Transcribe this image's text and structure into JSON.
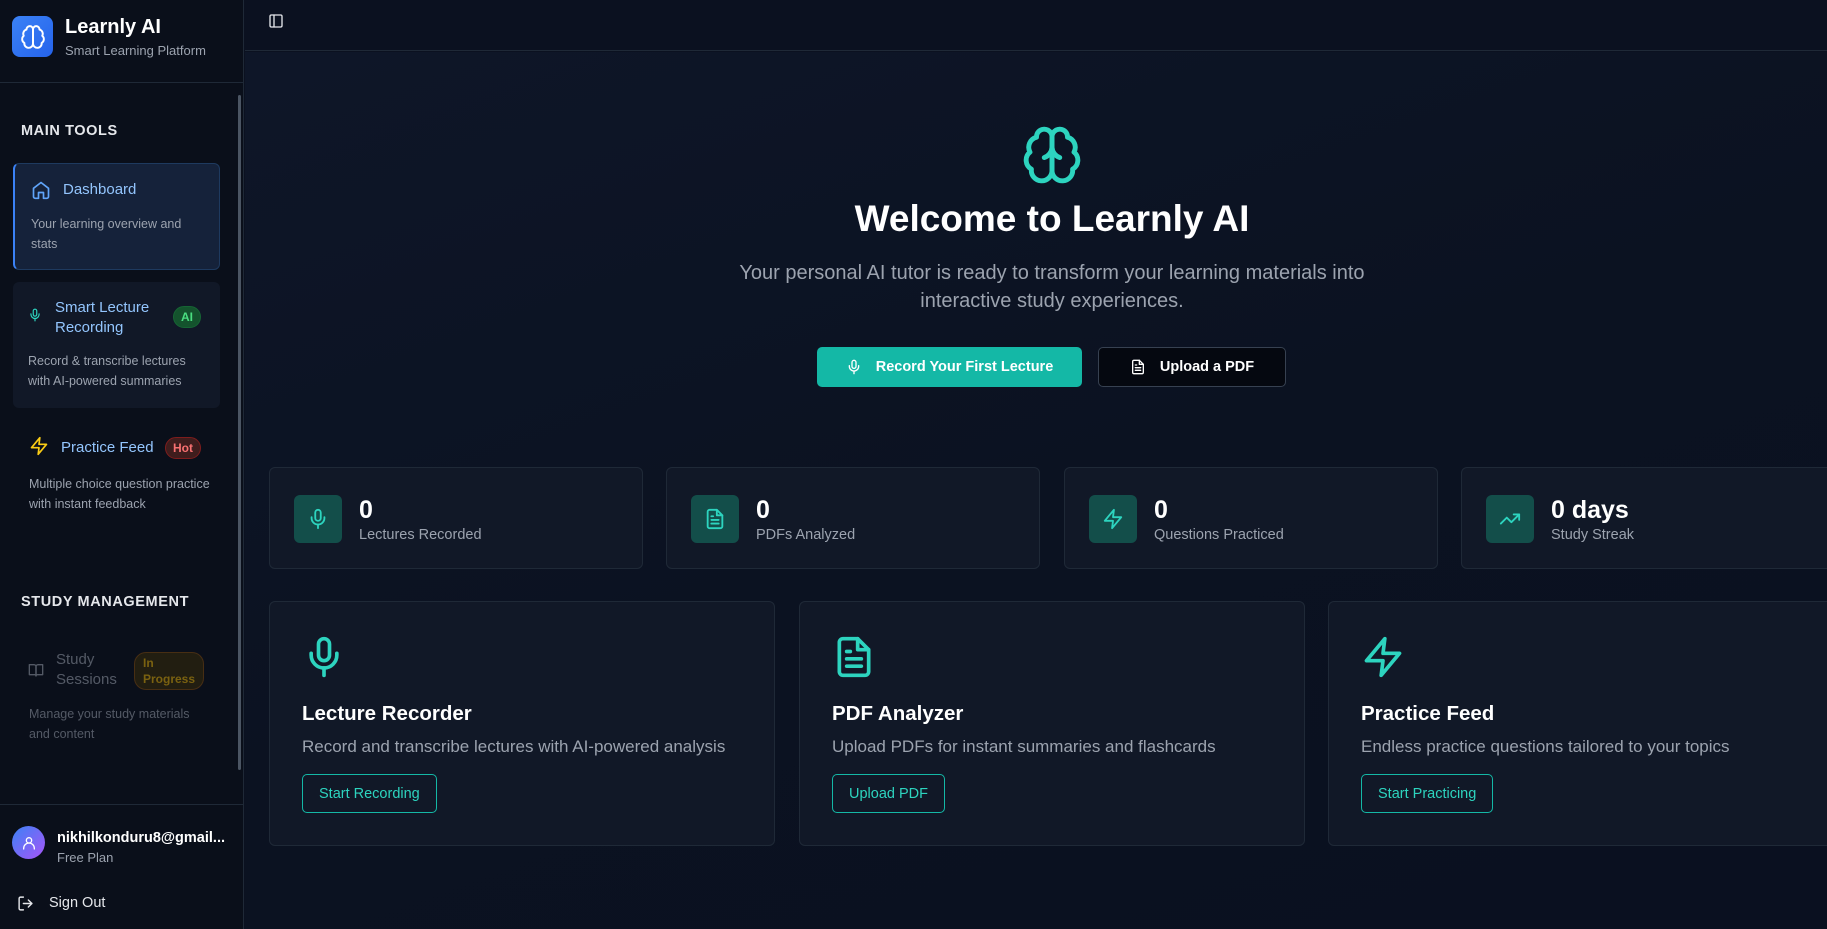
{
  "brand": {
    "name": "Learnly AI",
    "tagline": "Smart Learning Platform"
  },
  "sidebar": {
    "sections": [
      {
        "title": "MAIN TOOLS",
        "items": [
          {
            "label": "Dashboard",
            "description": "Your learning overview and stats",
            "icon": "home-icon",
            "badge": ""
          },
          {
            "label": "Smart Lecture Recording",
            "description": "Record & transcribe lectures with AI-powered summaries",
            "icon": "mic-icon",
            "badge": "AI"
          },
          {
            "label": "Practice Feed",
            "description": "Multiple choice question practice with instant feedback",
            "icon": "zap-icon",
            "badge": "Hot"
          }
        ]
      },
      {
        "title": "STUDY MANAGEMENT",
        "items": [
          {
            "label": "Study Sessions",
            "description": "Manage your study materials and content",
            "icon": "book-open-icon",
            "badge": "In Progress"
          }
        ]
      }
    ],
    "user": {
      "email": "nikhilkonduru8@gmail...",
      "plan": "Free Plan"
    },
    "sign_out": "Sign Out"
  },
  "hero": {
    "title": "Welcome to Learnly AI",
    "subtitle": "Your personal AI tutor is ready to transform your learning materials into interactive study experiences.",
    "primary_button": "Record Your First Lecture",
    "secondary_button": "Upload a PDF"
  },
  "stats": [
    {
      "value": "0",
      "label": "Lectures Recorded",
      "icon": "mic-icon"
    },
    {
      "value": "0",
      "label": "PDFs Analyzed",
      "icon": "file-text-icon"
    },
    {
      "value": "0",
      "label": "Questions Practiced",
      "icon": "zap-icon"
    },
    {
      "value": "0 days",
      "label": "Study Streak",
      "icon": "trending-up-icon"
    }
  ],
  "features": [
    {
      "title": "Lecture Recorder",
      "description": "Record and transcribe lectures with AI-powered analysis",
      "button": "Start Recording",
      "icon": "mic-icon"
    },
    {
      "title": "PDF Analyzer",
      "description": "Upload PDFs for instant summaries and flashcards",
      "button": "Upload PDF",
      "icon": "file-text-icon"
    },
    {
      "title": "Practice Feed",
      "description": "Endless practice questions tailored to your topics",
      "button": "Start Practicing",
      "icon": "zap-icon"
    }
  ],
  "colors": {
    "accent": "#14b8a6",
    "accent_light": "#2dd4bf",
    "brand_blue": "#3b82f6",
    "background": "#0b1120",
    "badge_ai": "#22c55e",
    "badge_hot": "#ef4444",
    "badge_progress": "#eab308"
  }
}
